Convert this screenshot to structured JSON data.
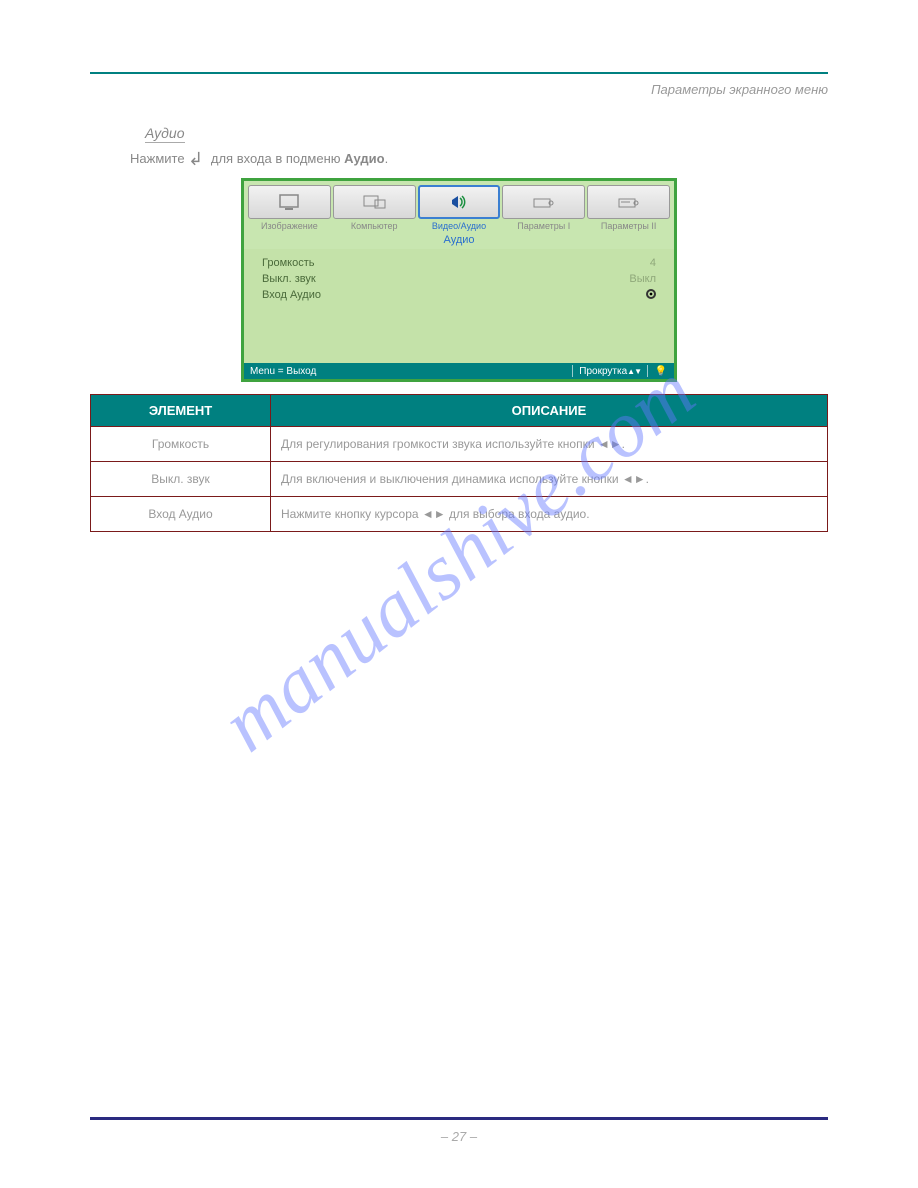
{
  "header": {
    "right": "Параметры экранного меню"
  },
  "section": {
    "heading": "Аудио",
    "instruction": "Нажмите              для входа в подменю Аудио."
  },
  "osd": {
    "tabs": [
      {
        "label": "Изображение",
        "active": false
      },
      {
        "label": "Компьютер",
        "active": false
      },
      {
        "label": "Видео/Аудио",
        "active": true
      },
      {
        "label": "Параметры I",
        "active": false
      },
      {
        "label": "Параметры II",
        "active": false
      }
    ],
    "title": "Аудио",
    "rows": [
      {
        "label": "Громкость",
        "value": "4"
      },
      {
        "label": "Выкл. звук",
        "value": "Выкл"
      },
      {
        "label": "Вход Аудио",
        "value": ""
      }
    ],
    "footer": {
      "left": "Menu = Выход",
      "right": "Прокрутка"
    }
  },
  "table": {
    "headers": [
      "ЭЛЕМЕНТ",
      "ОПИСАНИЕ"
    ],
    "rows": [
      {
        "item": "Громкость",
        "desc": "Для регулирования громкости звука используйте кнопки ◄►."
      },
      {
        "item": "Выкл. звук",
        "desc": "Для включения и выключения динамика используйте кнопки ◄►."
      },
      {
        "item": "Вход Аудио",
        "desc": "Нажмите кнопку курсора ◄► для выбора входа аудио."
      }
    ]
  },
  "footer": {
    "pageinfo": "– 27 –"
  },
  "watermark": "manualshive.com"
}
